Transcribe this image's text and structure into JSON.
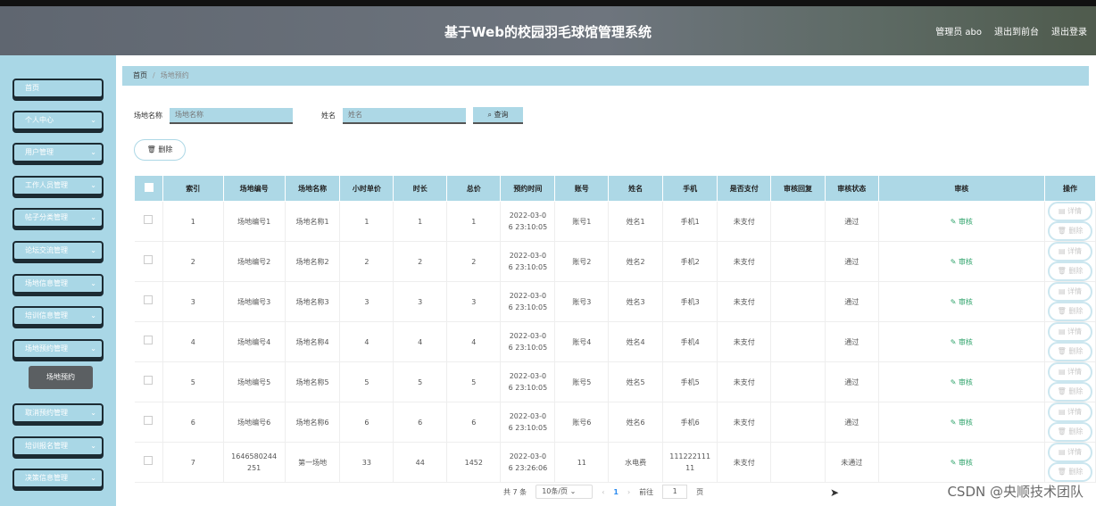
{
  "header": {
    "title": "基于Web的校园羽毛球馆管理系统",
    "admin": "管理员 abo",
    "back": "退出到前台",
    "logout": "退出登录"
  },
  "sidebar": {
    "items": [
      "首页",
      "个人中心",
      "用户管理",
      "工作人员管理",
      "帖子分类管理",
      "论坛交流管理",
      "场地信息管理",
      "培训信息管理",
      "场地预约管理",
      "取消预约管理",
      "培训报名管理",
      "决策信息管理"
    ],
    "submenu": "场地预约"
  },
  "breadcrumb": {
    "home": "首页",
    "current": "场地预约"
  },
  "search": {
    "venue_label": "场地名称",
    "venue_placeholder": "场地名称",
    "name_label": "姓名",
    "name_placeholder": "姓名",
    "button": "查询"
  },
  "delete_button": "删除",
  "table": {
    "headers": [
      "索引",
      "场地编号",
      "场地名称",
      "小时单价",
      "时长",
      "总价",
      "预约时间",
      "账号",
      "姓名",
      "手机",
      "是否支付",
      "审核回复",
      "审核状态",
      "审核",
      "操作"
    ],
    "review_label": "审核",
    "detail_label": "详情",
    "delete_label": "删除",
    "rows": [
      [
        "1",
        "场地编号1",
        "场地名称1",
        "1",
        "1",
        "1",
        "2022-03-0\n6 23:10:05",
        "账号1",
        "姓名1",
        "手机1",
        "未支付",
        "",
        "通过"
      ],
      [
        "2",
        "场地编号2",
        "场地名称2",
        "2",
        "2",
        "2",
        "2022-03-0\n6 23:10:05",
        "账号2",
        "姓名2",
        "手机2",
        "未支付",
        "",
        "通过"
      ],
      [
        "3",
        "场地编号3",
        "场地名称3",
        "3",
        "3",
        "3",
        "2022-03-0\n6 23:10:05",
        "账号3",
        "姓名3",
        "手机3",
        "未支付",
        "",
        "通过"
      ],
      [
        "4",
        "场地编号4",
        "场地名称4",
        "4",
        "4",
        "4",
        "2022-03-0\n6 23:10:05",
        "账号4",
        "姓名4",
        "手机4",
        "未支付",
        "",
        "通过"
      ],
      [
        "5",
        "场地编号5",
        "场地名称5",
        "5",
        "5",
        "5",
        "2022-03-0\n6 23:10:05",
        "账号5",
        "姓名5",
        "手机5",
        "未支付",
        "",
        "通过"
      ],
      [
        "6",
        "场地编号6",
        "场地名称6",
        "6",
        "6",
        "6",
        "2022-03-0\n6 23:10:05",
        "账号6",
        "姓名6",
        "手机6",
        "未支付",
        "",
        "通过"
      ],
      [
        "7",
        "1646580244\n251",
        "第一场地",
        "33",
        "44",
        "1452",
        "2022-03-0\n6 23:26:06",
        "11",
        "水电费",
        "111222111\n11",
        "未支付",
        "",
        "未通过"
      ]
    ]
  },
  "pager": {
    "total": "共 7 条",
    "page_size": "10条/页",
    "prev": "‹",
    "current": "1",
    "next": "›",
    "goto": "前往",
    "goto_value": "1",
    "page_unit": "页"
  },
  "watermark": "CSDN @央顺技术团队",
  "colors": {
    "accent": "#add8e6",
    "sidebar": "#a9d7e6",
    "review": "#2fa36b"
  }
}
